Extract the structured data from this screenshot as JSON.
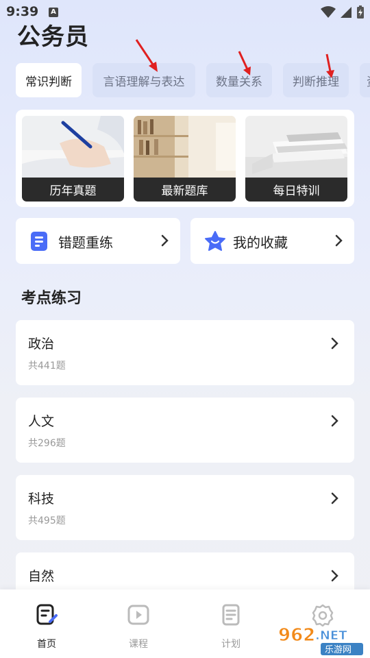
{
  "status": {
    "time": "9:39",
    "indicator": "A"
  },
  "page": {
    "title": "公务员"
  },
  "tabs": [
    {
      "label": "常识判断",
      "active": true
    },
    {
      "label": "言语理解与表达",
      "active": false
    },
    {
      "label": "数量关系",
      "active": false
    },
    {
      "label": "判断推理",
      "active": false
    },
    {
      "label": "资料分析",
      "active": false
    }
  ],
  "hero_tiles": [
    {
      "label": "历年真题",
      "image": "writing-hand-photo"
    },
    {
      "label": "最新题库",
      "image": "bookshelf-photo"
    },
    {
      "label": "每日特训",
      "image": "stacked-books-photo"
    }
  ],
  "quick_actions": {
    "wrong_practice": {
      "label": "错题重练",
      "icon": "document-icon"
    },
    "favorites": {
      "label": "我的收藏",
      "icon": "star-icon"
    }
  },
  "section": {
    "title": "考点练习"
  },
  "topics": [
    {
      "name": "政治",
      "count": "共441题"
    },
    {
      "name": "人文",
      "count": "共296题"
    },
    {
      "name": "科技",
      "count": "共495题"
    },
    {
      "name": "自然",
      "count": ""
    }
  ],
  "bottom_nav": [
    {
      "label": "首页",
      "icon": "edit-document-icon",
      "active": true
    },
    {
      "label": "课程",
      "icon": "play-icon",
      "active": false
    },
    {
      "label": "计划",
      "icon": "notes-icon",
      "active": false
    },
    {
      "label": "",
      "icon": "settings-icon",
      "active": false
    }
  ],
  "watermark": {
    "text": "962.NET",
    "sub": "乐游网"
  },
  "colors": {
    "accent": "#4a6cf7",
    "tab_bg": "#d9e1f7",
    "annotation_arrow": "#e02020"
  }
}
